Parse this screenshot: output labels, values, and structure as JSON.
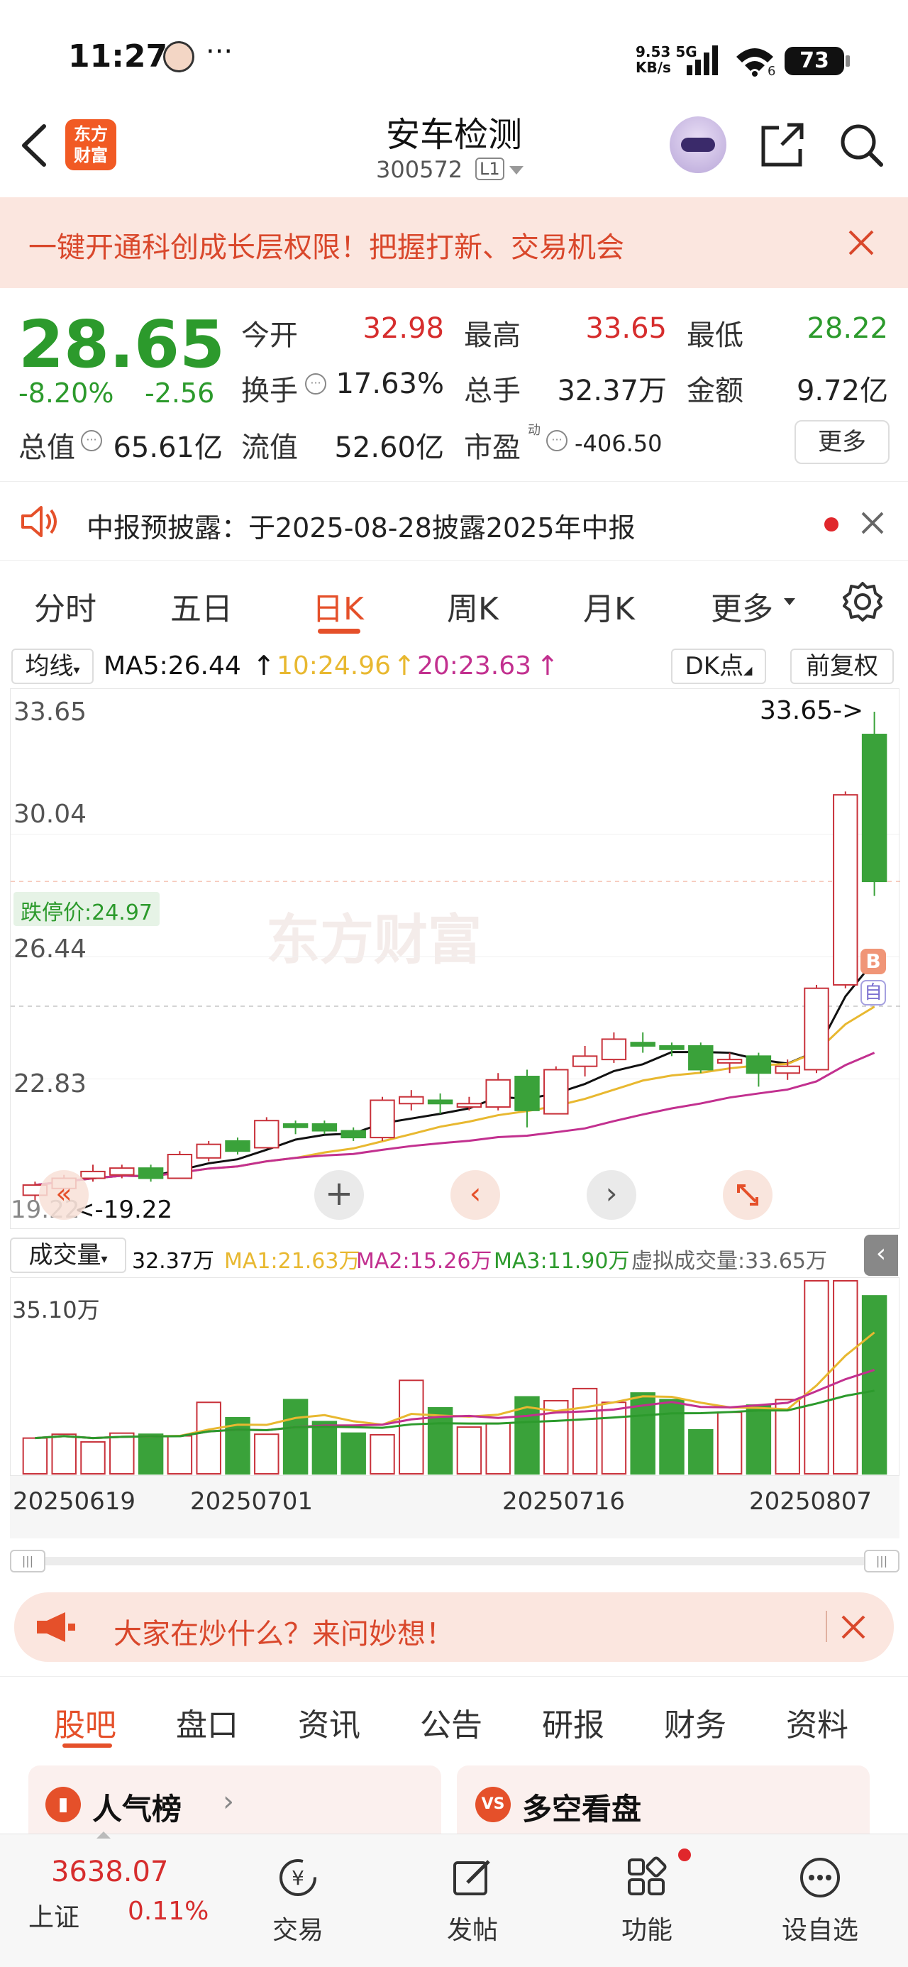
{
  "status_bar": {
    "time": "11:27",
    "dots": "···",
    "net_speed": "9.53",
    "net_unit": "KB/s",
    "net_type": "5G",
    "wifi_sub": "6",
    "battery": "73"
  },
  "header": {
    "logo_line1": "东方",
    "logo_line2": "财富",
    "stock_name": "安车检测",
    "stock_code": "300572",
    "level": "L1"
  },
  "promo": {
    "text": "一键开通科创成长层权限！把握打新、交易机会"
  },
  "quote": {
    "price": "28.65",
    "change_pct": "-8.20%",
    "change_amt": "-2.56",
    "fields": [
      {
        "label": "今开",
        "value": "32.98"
      },
      {
        "label": "最高",
        "value": "33.65"
      },
      {
        "label": "最低",
        "value": "28.22"
      },
      {
        "label": "换手",
        "value": "17.63%"
      },
      {
        "label": "总手",
        "value": "32.37万"
      },
      {
        "label": "金额",
        "value": "9.72亿"
      },
      {
        "label": "总值",
        "value": "65.61亿"
      },
      {
        "label": "流值",
        "value": "52.60亿"
      },
      {
        "label": "市盈",
        "value": "-406.50"
      }
    ],
    "pe_sup": "动",
    "more": "更多"
  },
  "notice": {
    "text": "中报预披露：于2025-08-28披露2025年中报"
  },
  "kline_tabs": [
    "分时",
    "五日",
    "日K",
    "周K",
    "月K",
    "更多"
  ],
  "ma_row": {
    "selector": "均线",
    "ma5": "MA5:26.44",
    "ma10": "10:24.96",
    "ma20": "20:23.63",
    "dk": "DK点",
    "adjust": "前复权"
  },
  "price_chart": {
    "y_ticks": [
      "33.65",
      "30.04",
      "26.44",
      "22.83"
    ],
    "high_label": "33.65->",
    "low_label": "<-19.22",
    "low_axis": "19.22",
    "limit_down": "跌停价:24.97",
    "watermark": "东方财富",
    "marker_b": "B",
    "marker_self": "自"
  },
  "vol_row": {
    "selector": "成交量",
    "vol": "32.37万",
    "ma1": "MA1:21.63万",
    "ma2": "MA2:15.26万",
    "ma3": "MA3:11.90万",
    "virtual": "虚拟成交量:33.65万",
    "max_label": "35.10万"
  },
  "dates": [
    "20250619",
    "20250701",
    "20250716",
    "20250807"
  ],
  "ask": {
    "text": "大家在炒什么？来问妙想！"
  },
  "bottom_tabs": [
    "股吧",
    "盘口",
    "资讯",
    "公告",
    "研报",
    "财务",
    "资料"
  ],
  "cards": [
    {
      "label": "人气榜"
    },
    {
      "label": "多空看盘",
      "badge": "VS"
    }
  ],
  "index": {
    "value": "3638.07",
    "name": "上证",
    "pct": "0.11%"
  },
  "nav": [
    "交易",
    "发帖",
    "功能",
    "设自选"
  ],
  "chart_data": {
    "type": "candlestick",
    "candles": [
      {
        "o": 19.4,
        "c": 19.7,
        "h": 19.8,
        "l": 19.22
      },
      {
        "o": 19.6,
        "c": 19.9,
        "h": 20.0,
        "l": 19.4
      },
      {
        "o": 19.9,
        "c": 20.1,
        "h": 20.3,
        "l": 19.8
      },
      {
        "o": 20.0,
        "c": 20.2,
        "h": 20.3,
        "l": 19.9
      },
      {
        "o": 20.2,
        "c": 19.9,
        "h": 20.3,
        "l": 19.8
      },
      {
        "o": 19.9,
        "c": 20.6,
        "h": 20.7,
        "l": 19.9
      },
      {
        "o": 20.5,
        "c": 20.9,
        "h": 21.0,
        "l": 20.4
      },
      {
        "o": 21.0,
        "c": 20.7,
        "h": 21.1,
        "l": 20.6
      },
      {
        "o": 20.8,
        "c": 21.6,
        "h": 21.7,
        "l": 20.8
      },
      {
        "o": 21.5,
        "c": 21.4,
        "h": 21.6,
        "l": 21.2
      },
      {
        "o": 21.5,
        "c": 21.3,
        "h": 21.6,
        "l": 21.2
      },
      {
        "o": 21.3,
        "c": 21.1,
        "h": 21.4,
        "l": 21.0
      },
      {
        "o": 21.1,
        "c": 22.2,
        "h": 22.3,
        "l": 21.0
      },
      {
        "o": 22.1,
        "c": 22.3,
        "h": 22.5,
        "l": 21.9
      },
      {
        "o": 22.2,
        "c": 22.1,
        "h": 22.4,
        "l": 21.8
      },
      {
        "o": 22.0,
        "c": 22.1,
        "h": 22.3,
        "l": 21.9
      },
      {
        "o": 22.0,
        "c": 22.8,
        "h": 23.0,
        "l": 21.9
      },
      {
        "o": 22.9,
        "c": 21.9,
        "h": 23.1,
        "l": 21.4
      },
      {
        "o": 21.8,
        "c": 23.1,
        "h": 23.2,
        "l": 21.8
      },
      {
        "o": 23.2,
        "c": 23.5,
        "h": 23.8,
        "l": 22.9
      },
      {
        "o": 23.4,
        "c": 24.0,
        "h": 24.2,
        "l": 23.3
      },
      {
        "o": 23.9,
        "c": 23.8,
        "h": 24.2,
        "l": 23.6
      },
      {
        "o": 23.8,
        "c": 23.7,
        "h": 23.9,
        "l": 23.5
      },
      {
        "o": 23.8,
        "c": 23.1,
        "h": 23.9,
        "l": 23.0
      },
      {
        "o": 23.3,
        "c": 23.4,
        "h": 23.6,
        "l": 23.0
      },
      {
        "o": 23.5,
        "c": 23.0,
        "h": 23.6,
        "l": 22.6
      },
      {
        "o": 23.0,
        "c": 23.2,
        "h": 23.4,
        "l": 22.8
      },
      {
        "o": 23.1,
        "c": 25.5,
        "h": 25.6,
        "l": 23.0
      },
      {
        "o": 25.6,
        "c": 31.2,
        "h": 31.3,
        "l": 25.5
      },
      {
        "o": 32.98,
        "c": 28.65,
        "h": 33.65,
        "l": 28.22
      }
    ],
    "volume_wan": [
      6.5,
      7.2,
      5.8,
      7.4,
      7.2,
      6.9,
      13.0,
      10.2,
      7.2,
      13.5,
      9.5,
      7.4,
      7.1,
      17.0,
      12.0,
      8.5,
      9.2,
      14.0,
      13.3,
      15.5,
      13.0,
      14.7,
      13.5,
      8.0,
      11.2,
      12.5,
      13.5,
      35.1,
      35.1,
      32.37
    ],
    "y_range": [
      19.22,
      33.65
    ],
    "vol_max_wan": 35.1
  }
}
